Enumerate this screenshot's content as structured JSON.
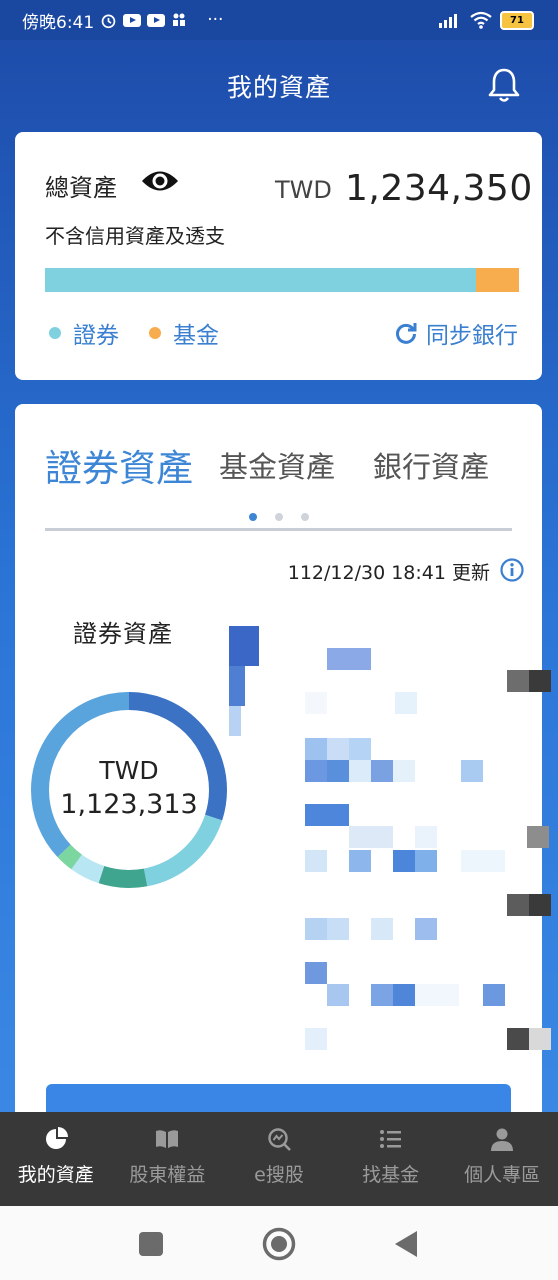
{
  "status_bar": {
    "time": "傍晚6:41",
    "more": "···",
    "battery": "71"
  },
  "header": {
    "title": "我的資產",
    "bell_icon": "bell-icon"
  },
  "total_assets": {
    "label": "總資產",
    "eye_icon": "eye-icon",
    "note": "不含信用資產及透支",
    "currency": "TWD",
    "amount": "1,234,350",
    "allocation": [
      {
        "name": "證券",
        "fraction": 0.91,
        "color": "#7fd1e0"
      },
      {
        "name": "基金",
        "fraction": 0.09,
        "color": "#f7ad4d"
      }
    ],
    "legend": [
      {
        "label": "證券",
        "color": "#7fd1e0"
      },
      {
        "label": "基金",
        "color": "#f7ad4d"
      }
    ],
    "sync_label": "同步銀行",
    "accent": "#3a7fd0"
  },
  "assets": {
    "tabs": [
      {
        "label": "證券資產",
        "active": true
      },
      {
        "label": "基金資產",
        "active": false
      },
      {
        "label": "銀行資產",
        "active": false
      }
    ],
    "page_dots": 3,
    "active_page": 0,
    "updated": "112/12/30 18:41 更新",
    "section_title": "證券資產",
    "donut_currency": "TWD",
    "donut_value": "1,123,313",
    "donut_segments": [
      {
        "fraction": 0.3,
        "color": "#3b72c4"
      },
      {
        "fraction": 0.17,
        "color": "#7fd1e0"
      },
      {
        "fraction": 0.08,
        "color": "#3fa58e"
      },
      {
        "fraction": 0.05,
        "color": "#b8e6f2"
      },
      {
        "fraction": 0.03,
        "color": "#7cd6a0"
      },
      {
        "fraction": 0.37,
        "color": "#5aa4dd"
      }
    ]
  },
  "bottom_nav": [
    {
      "label": "我的資產",
      "icon": "pie-chart-icon",
      "active": true
    },
    {
      "label": "股東權益",
      "icon": "book-icon",
      "active": false
    },
    {
      "label": "e搜股",
      "icon": "stock-search-icon",
      "active": false
    },
    {
      "label": "找基金",
      "icon": "list-icon",
      "active": false
    },
    {
      "label": "個人專區",
      "icon": "person-icon",
      "active": false
    }
  ],
  "system_nav": {
    "recent_icon": "square-icon",
    "home_icon": "circle-home-icon",
    "back_icon": "triangle-back-icon"
  }
}
